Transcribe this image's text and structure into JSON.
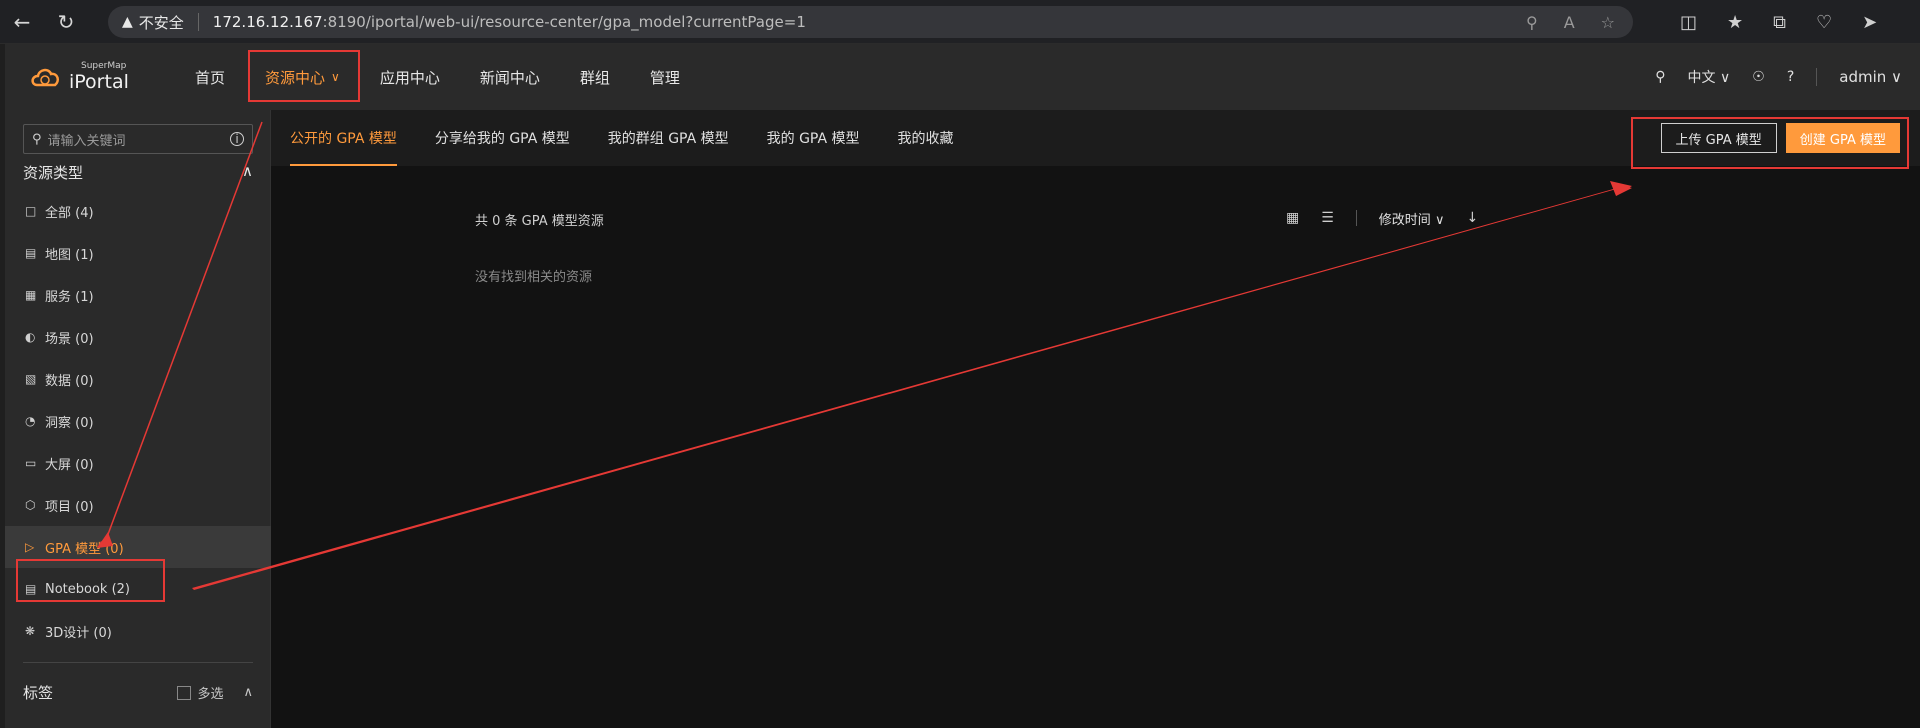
{
  "browser": {
    "security": "不安全",
    "host": "172.16.12.167",
    "path": ":8190/iportal/web-ui/resource-center/gpa_model?currentPage=1"
  },
  "logo": {
    "small": "SuperMap",
    "big": "iPortal"
  },
  "menu": {
    "home": "首页",
    "resource_center": "资源中心",
    "app_center": "应用中心",
    "news_center": "新闻中心",
    "groups": "群组",
    "manage": "管理"
  },
  "top_right": {
    "language": "中文",
    "user": "admin"
  },
  "sidebar": {
    "search_placeholder": "请输入关键词",
    "resource_type_title": "资源类型",
    "items": [
      {
        "label": "全部 (4)",
        "icon": "folder-icon"
      },
      {
        "label": "地图 (1)",
        "icon": "map-icon"
      },
      {
        "label": "服务 (1)",
        "icon": "service-icon"
      },
      {
        "label": "场景 (0)",
        "icon": "scene-icon"
      },
      {
        "label": "数据 (0)",
        "icon": "data-icon"
      },
      {
        "label": "洞察 (0)",
        "icon": "insight-icon"
      },
      {
        "label": "大屏 (0)",
        "icon": "dashboard-icon"
      },
      {
        "label": "项目 (0)",
        "icon": "project-icon"
      },
      {
        "label": "GPA 模型 (0)",
        "icon": "gpa-icon"
      },
      {
        "label": "Notebook (2)",
        "icon": "notebook-icon"
      },
      {
        "label": "3D设计 (0)",
        "icon": "3d-icon"
      }
    ],
    "tags_title": "标签",
    "multi_select": "多选"
  },
  "tabs": [
    "公开的 GPA 模型",
    "分享给我的 GPA 模型",
    "我的群组 GPA 模型",
    "我的 GPA 模型",
    "我的收藏"
  ],
  "actions": {
    "upload": "上传 GPA 模型",
    "create": "创建 GPA 模型"
  },
  "content": {
    "count": "共 0 条 GPA 模型资源",
    "empty": "没有找到相关的资源",
    "sort": "修改时间"
  },
  "colors": {
    "accent": "#ff9a3c",
    "annotation": "#e53935"
  }
}
